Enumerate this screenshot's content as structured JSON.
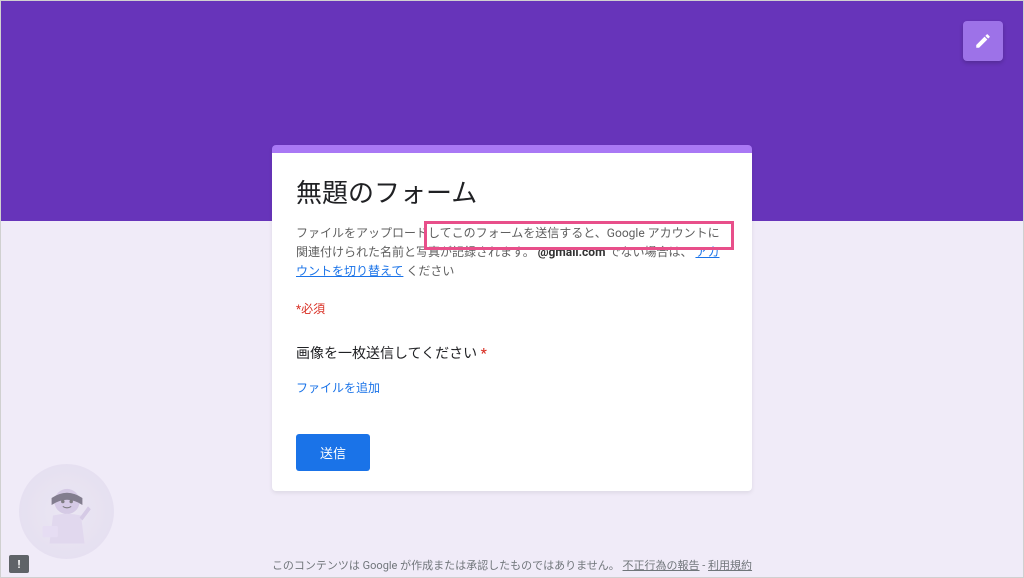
{
  "form": {
    "title": "無題のフォーム",
    "description_part1": "ファイルをアップロードしてこのフォームを送信すると、Google アカウントに関連付けられた名前と写真が記録されます。",
    "email": "@gmail.com",
    "email_suffix": " でない場合は、",
    "switch_account": "アカウントを切り替えて",
    "description_part2": "ください",
    "required_note": "*必須",
    "question": "画像を一枚送信してください",
    "asterisk": "*",
    "add_file": "ファイルを追加",
    "submit": "送信"
  },
  "footer": {
    "disclaimer": "このコンテンツは Google が作成または承認したものではありません。",
    "report_abuse": "不正行為の報告",
    "separator": " - ",
    "terms": "利用規約"
  }
}
